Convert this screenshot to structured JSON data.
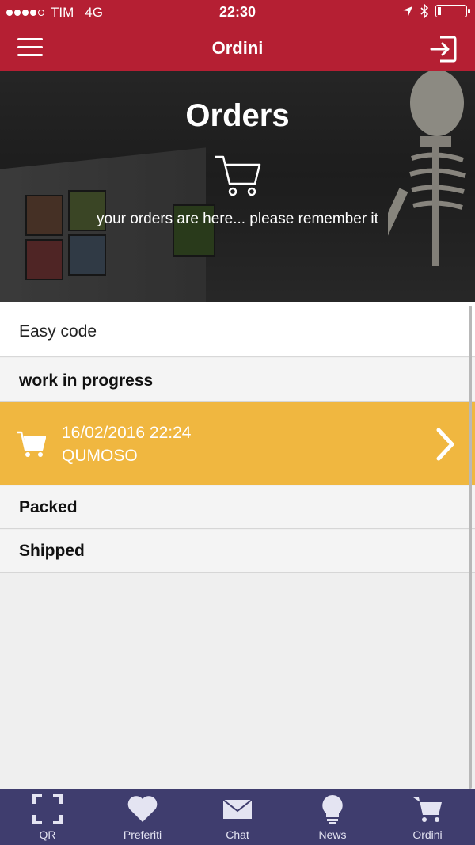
{
  "status_bar": {
    "carrier": "TIM",
    "network": "4G",
    "time": "22:30"
  },
  "header": {
    "title": "Ordini"
  },
  "hero": {
    "title": "Orders",
    "subtitle": "your orders are here... please remember it"
  },
  "easy_code": {
    "label": "Easy code"
  },
  "sections": {
    "work_in_progress": "work in progress",
    "packed": "Packed",
    "shipped": "Shipped"
  },
  "order": {
    "date": "16/02/2016 22:24",
    "code": "QUMOSO"
  },
  "tabs": [
    {
      "label": "QR",
      "icon": "qr-scan-icon"
    },
    {
      "label": "Preferiti",
      "icon": "heart-icon"
    },
    {
      "label": "Chat",
      "icon": "envelope-icon"
    },
    {
      "label": "News",
      "icon": "lightbulb-icon"
    },
    {
      "label": "Ordini",
      "icon": "cart-icon"
    }
  ],
  "colors": {
    "brand_red": "#b51f33",
    "order_highlight": "#f0b740",
    "tab_bar": "#3f3d6e"
  }
}
